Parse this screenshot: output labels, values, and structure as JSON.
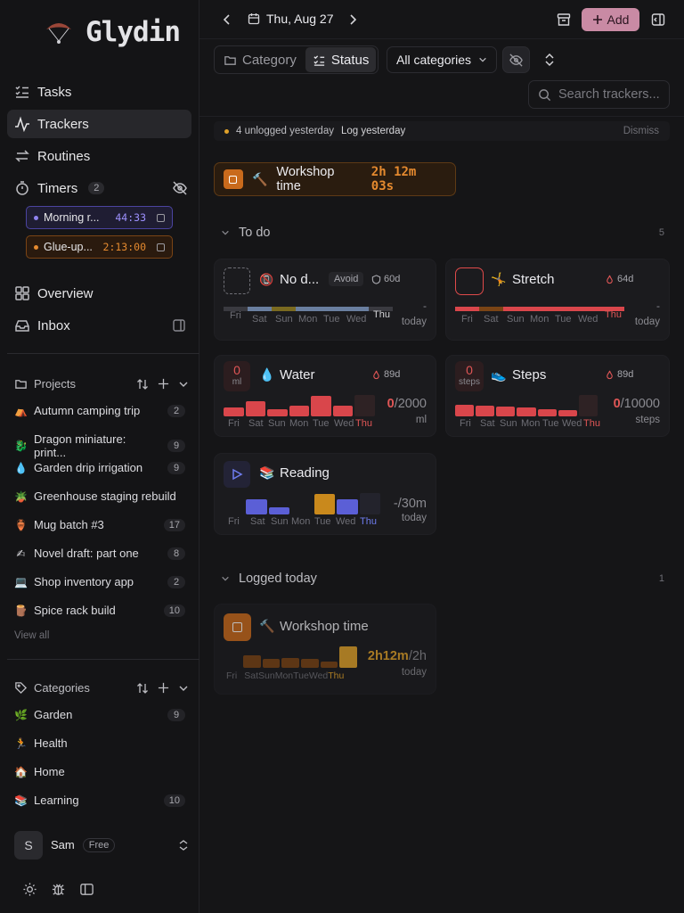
{
  "app": {
    "name": "Glydin"
  },
  "nav": [
    {
      "label": "Tasks",
      "icon": "tasks-icon"
    },
    {
      "label": "Trackers",
      "icon": "trackers-icon"
    },
    {
      "label": "Routines",
      "icon": "routines-icon"
    },
    {
      "label": "Timers",
      "icon": "timer-icon",
      "badge": "2"
    },
    {
      "label": "Overview",
      "icon": "overview-icon"
    },
    {
      "label": "Inbox",
      "icon": "inbox-icon"
    }
  ],
  "timers": [
    {
      "name": "Morning r...",
      "time": "44:33"
    },
    {
      "name": "Glue-up...",
      "time": "2:13:00"
    }
  ],
  "projects": {
    "heading": "Projects",
    "items": [
      {
        "emoji": "⛺",
        "name": "Autumn camping trip",
        "count": "2"
      },
      {
        "emoji": "🐉",
        "name": "Dragon miniature: print...",
        "count": "9"
      },
      {
        "emoji": "💧",
        "name": "Garden drip irrigation",
        "count": "9"
      },
      {
        "emoji": "🪴",
        "name": "Greenhouse staging rebuild",
        "count": ""
      },
      {
        "emoji": "🏺",
        "name": "Mug batch #3",
        "count": "17"
      },
      {
        "emoji": "✍",
        "name": "Novel draft: part one",
        "count": "8"
      },
      {
        "emoji": "💻",
        "name": "Shop inventory app",
        "count": "2"
      },
      {
        "emoji": "🪵",
        "name": "Spice rack build",
        "count": "10"
      }
    ],
    "view_all": "View all"
  },
  "categories": {
    "heading": "Categories",
    "items": [
      {
        "emoji": "🌿",
        "name": "Garden",
        "count": "9"
      },
      {
        "emoji": "🏃",
        "name": "Health",
        "count": ""
      },
      {
        "emoji": "🏠",
        "name": "Home",
        "count": ""
      },
      {
        "emoji": "📚",
        "name": "Learning",
        "count": "10"
      }
    ]
  },
  "user": {
    "initial": "S",
    "name": "Sam",
    "plan": "Free"
  },
  "topbar": {
    "date": "Thu, Aug 27",
    "add_label": "Add"
  },
  "toolbar": {
    "category_label": "Category",
    "status_label": "Status",
    "filter_label": "All categories",
    "search_placeholder": "Search trackers..."
  },
  "notice": {
    "text": "4 unlogged yesterday",
    "action": "Log yesterday",
    "dismiss": "Dismiss"
  },
  "active_timer": {
    "emoji": "🔨",
    "label": "Workshop time",
    "time": "2h 12m 03s"
  },
  "sections": {
    "todo": {
      "label": "To do",
      "count": "5"
    },
    "logged": {
      "label": "Logged today",
      "count": "1"
    }
  },
  "days": [
    "Fri",
    "Sat",
    "Sun",
    "Mon",
    "Tue",
    "Wed",
    "Thu"
  ],
  "trackers": {
    "no_doom": {
      "emoji": "📵",
      "name": "No d...",
      "tag": "Avoid",
      "streak": "60d",
      "value": "-",
      "unit": "today"
    },
    "stretch": {
      "emoji": "🤸",
      "name": "Stretch",
      "streak": "64d",
      "value": "-",
      "unit": "today"
    },
    "water": {
      "emoji": "💧",
      "name": "Water",
      "streak": "89d",
      "counter": "0",
      "counter_unit": "ml",
      "value": "0",
      "target": "/2000",
      "unit": "ml",
      "levels": [
        0.4,
        0.7,
        0.35,
        0.5,
        0.95,
        0.5,
        1.0
      ]
    },
    "steps": {
      "emoji": "👟",
      "name": "Steps",
      "streak": "89d",
      "counter": "0",
      "counter_unit": "steps",
      "value": "0",
      "target": "/10000",
      "unit": "steps",
      "levels": [
        0.55,
        0.5,
        0.45,
        0.4,
        0.35,
        0.3,
        1.0
      ]
    },
    "reading": {
      "emoji": "📚",
      "name": "Reading",
      "value": "-",
      "target": "/30m",
      "unit": "today",
      "levels": [
        0,
        0.7,
        0.35,
        0,
        0.95,
        0.7,
        1.0
      ]
    },
    "workshop": {
      "emoji": "🔨",
      "name": "Workshop time",
      "value": "2h12m",
      "target": "/2h",
      "unit": "today",
      "levels": [
        0.6,
        0.4,
        0.45,
        0.4,
        0.3,
        1.0
      ]
    }
  },
  "workshop_days": [
    "Fri",
    "Sat",
    "Sun",
    "Mon",
    "Tue",
    "Wed",
    "Thu"
  ],
  "colors": {
    "red": "#d9464b",
    "amber": "#e0a12a",
    "brown": "#7a4415",
    "blue": "#5b5fd6",
    "add_button": "#c98aa4",
    "accent_purple": "#8f82f0",
    "accent_orange": "#e58a2f"
  }
}
